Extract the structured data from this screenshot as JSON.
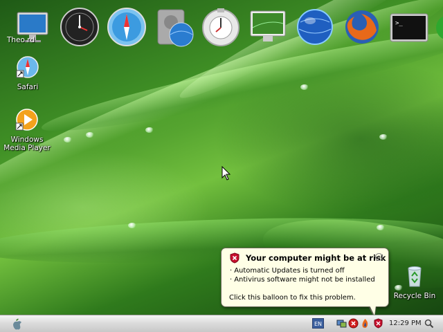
{
  "desktop": {
    "icons": [
      {
        "label": "Safari"
      },
      {
        "label": "Windows Media Player"
      },
      {
        "label": "Recycle Bin"
      }
    ],
    "partial_label": "Theo   rd"
  },
  "dock": {
    "items": [
      "imac-icon",
      "dashboard-clock-icon",
      "safari-compass-icon",
      "drive-globe-icon",
      "system-preferences-icon",
      "display-icon",
      "browser-globe-icon",
      "firefox-icon",
      "terminal-icon",
      "partial-icon"
    ]
  },
  "balloon": {
    "title": "Your computer might be at risk",
    "lines": [
      "Automatic Updates is turned off",
      "Antivirus software might not be installed"
    ],
    "cta": "Click this balloon to fix this problem.",
    "close": "o"
  },
  "taskbar": {
    "language": "EN",
    "clock": "12:29 PM"
  },
  "colors": {
    "balloon_bg": "#ffffe6",
    "warning_red": "#c8102e",
    "taskbar": "#dcdcdc"
  }
}
